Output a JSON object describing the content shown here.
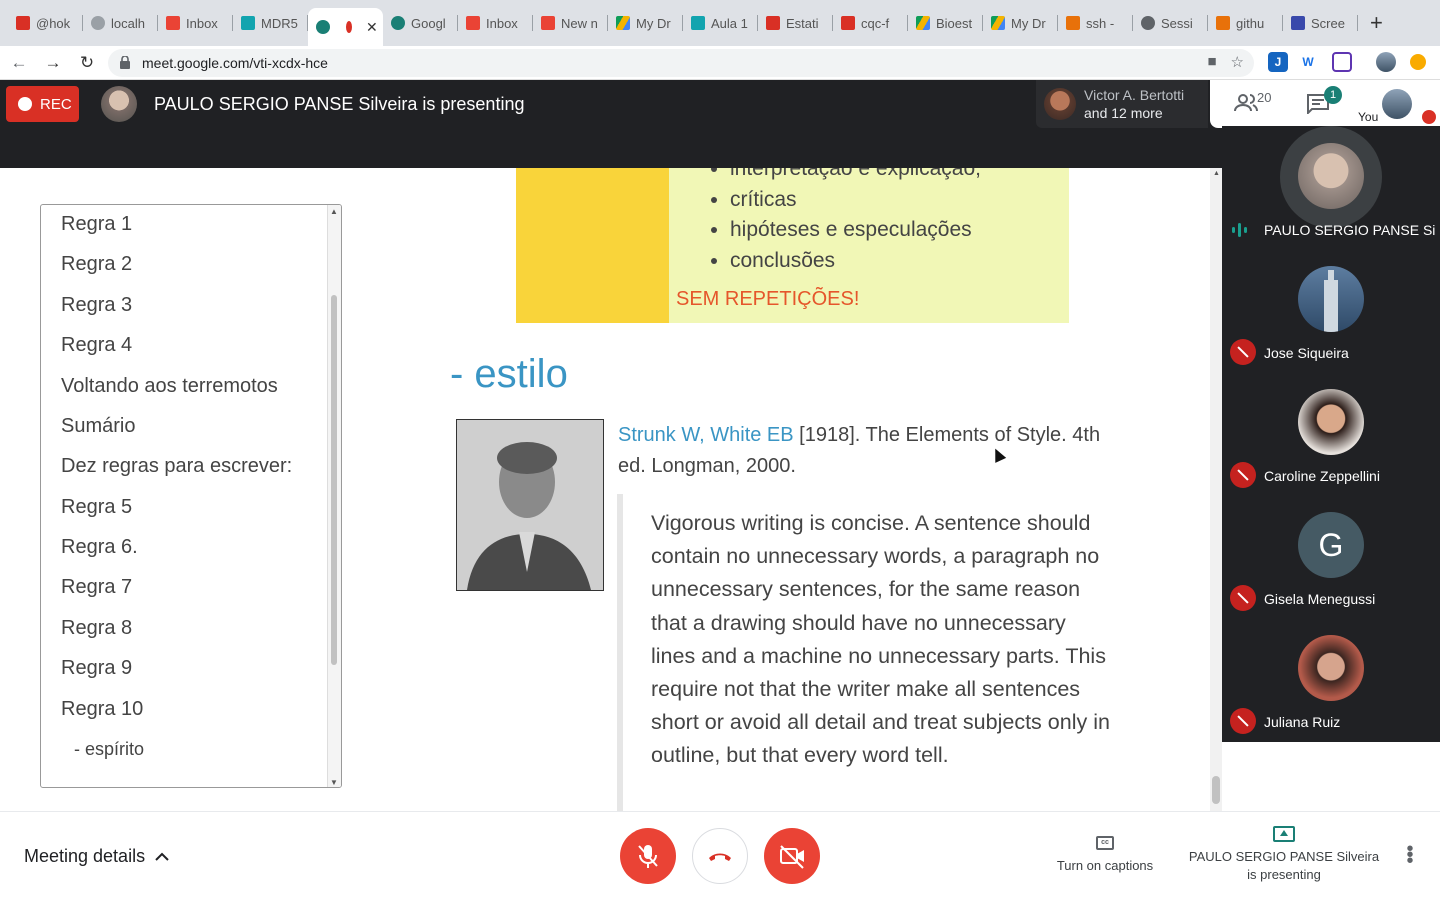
{
  "browser": {
    "tabs": [
      {
        "title": "@hok",
        "color": "#d93025"
      },
      {
        "title": "localh",
        "color": "#9aa0a6"
      },
      {
        "title": "Inbox",
        "color": "#ea4335"
      },
      {
        "title": "MDR5",
        "color": "#12a4af"
      },
      {
        "title": "",
        "color": "#1a7f75",
        "active": true
      },
      {
        "title": "Googl",
        "color": "#1a7f75"
      },
      {
        "title": "Inbox",
        "color": "#ea4335"
      },
      {
        "title": "New n",
        "color": "#ea4335"
      },
      {
        "title": "My Dr",
        "color": "#f4b400"
      },
      {
        "title": "Aula 1",
        "color": "#12a4af"
      },
      {
        "title": "Estati",
        "color": "#d93025"
      },
      {
        "title": "cqc-f",
        "color": "#d93025"
      },
      {
        "title": "Bioest",
        "color": "#f4b400"
      },
      {
        "title": "My Dr",
        "color": "#f4b400"
      },
      {
        "title": "ssh -",
        "color": "#e8710a"
      },
      {
        "title": "Sessi",
        "color": "#5f6368"
      },
      {
        "title": "githu",
        "color": "#e8710a"
      },
      {
        "title": "Scree",
        "color": "#3949ab"
      }
    ],
    "url": "meet.google.com/vti-xcdx-hce"
  },
  "meet": {
    "rec_label": "REC",
    "presenting_title": "PAULO SERGIO PANSE Silveira is presenting",
    "speaking_line1": "Victor A. Bertotti",
    "speaking_line2": "and 12 more",
    "participant_count": "20",
    "chat_badge": "1",
    "you_label": "You"
  },
  "slide": {
    "outline": [
      "Regra 1",
      "Regra 2",
      "Regra 3",
      "Regra 4",
      "Voltando aos terremotos",
      "Sumário",
      "Dez regras para escrever:",
      "Regra 5",
      "Regra 6.",
      "Regra 7",
      "Regra 8",
      "Regra 9",
      "Regra 10",
      "- espírito"
    ],
    "bullets": [
      "interpretação e explicação;",
      "críticas",
      "hipóteses e especulações",
      "conclusões"
    ],
    "warning": "SEM REPETIÇÕES!",
    "heading": "- estilo",
    "citation_link": "Strunk W, White EB",
    "citation_rest": " [1918]. The Elements of Style. 4th ed. Longman, 2000.",
    "quote": "Vigorous writing is concise. A sentence should contain no unnecessary words, a paragraph no unnecessary sentences, for the same reason that a drawing should have no unnecessary lines and a machine no unnecessary parts. This require not that the writer make all sentences short or avoid all detail and treat subjects only in outline, but that every word tell."
  },
  "participants": [
    {
      "name": "PAULO SERGIO PANSE Sil...",
      "speaking": true
    },
    {
      "name": "Jose Siqueira",
      "muted": true
    },
    {
      "name": "Caroline Zeppellini",
      "muted": true
    },
    {
      "name": "Gisela Menegussi",
      "muted": true,
      "initial": "G"
    },
    {
      "name": "Juliana Ruiz",
      "muted": true
    }
  ],
  "bottom": {
    "meeting_details": "Meeting details",
    "captions": "Turn on captions",
    "presenting": "PAULO SERGIO PANSE Silveira is presenting"
  }
}
